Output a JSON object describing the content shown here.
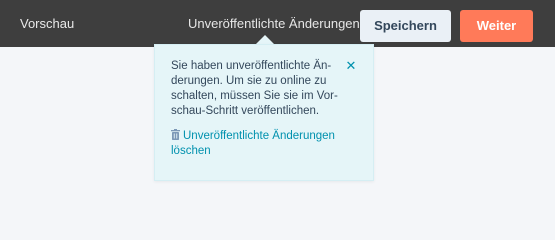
{
  "topbar": {
    "preview_label": "Vorschau",
    "unsaved_changes_label": "Unveröffentlichte Änderungen",
    "save_label": "Speichern",
    "next_label": "Weiter"
  },
  "popover": {
    "message": "Sie haben unveröffentlichte Än-derungen. Um sie zu online zu schalten, müssen Sie sie im Vor-schau-Schritt veröffentlichen.",
    "close_icon": "close-icon",
    "discard_label": "Unveröffentlichte Änderungen löschen",
    "discard_icon": "trash-icon"
  },
  "colors": {
    "topbar_bg": "#3e3e3e",
    "accent": "#ff7a59",
    "link": "#0091ae",
    "popover_bg": "#e5f5f8",
    "secondary_button_bg": "#eaf0f6"
  }
}
